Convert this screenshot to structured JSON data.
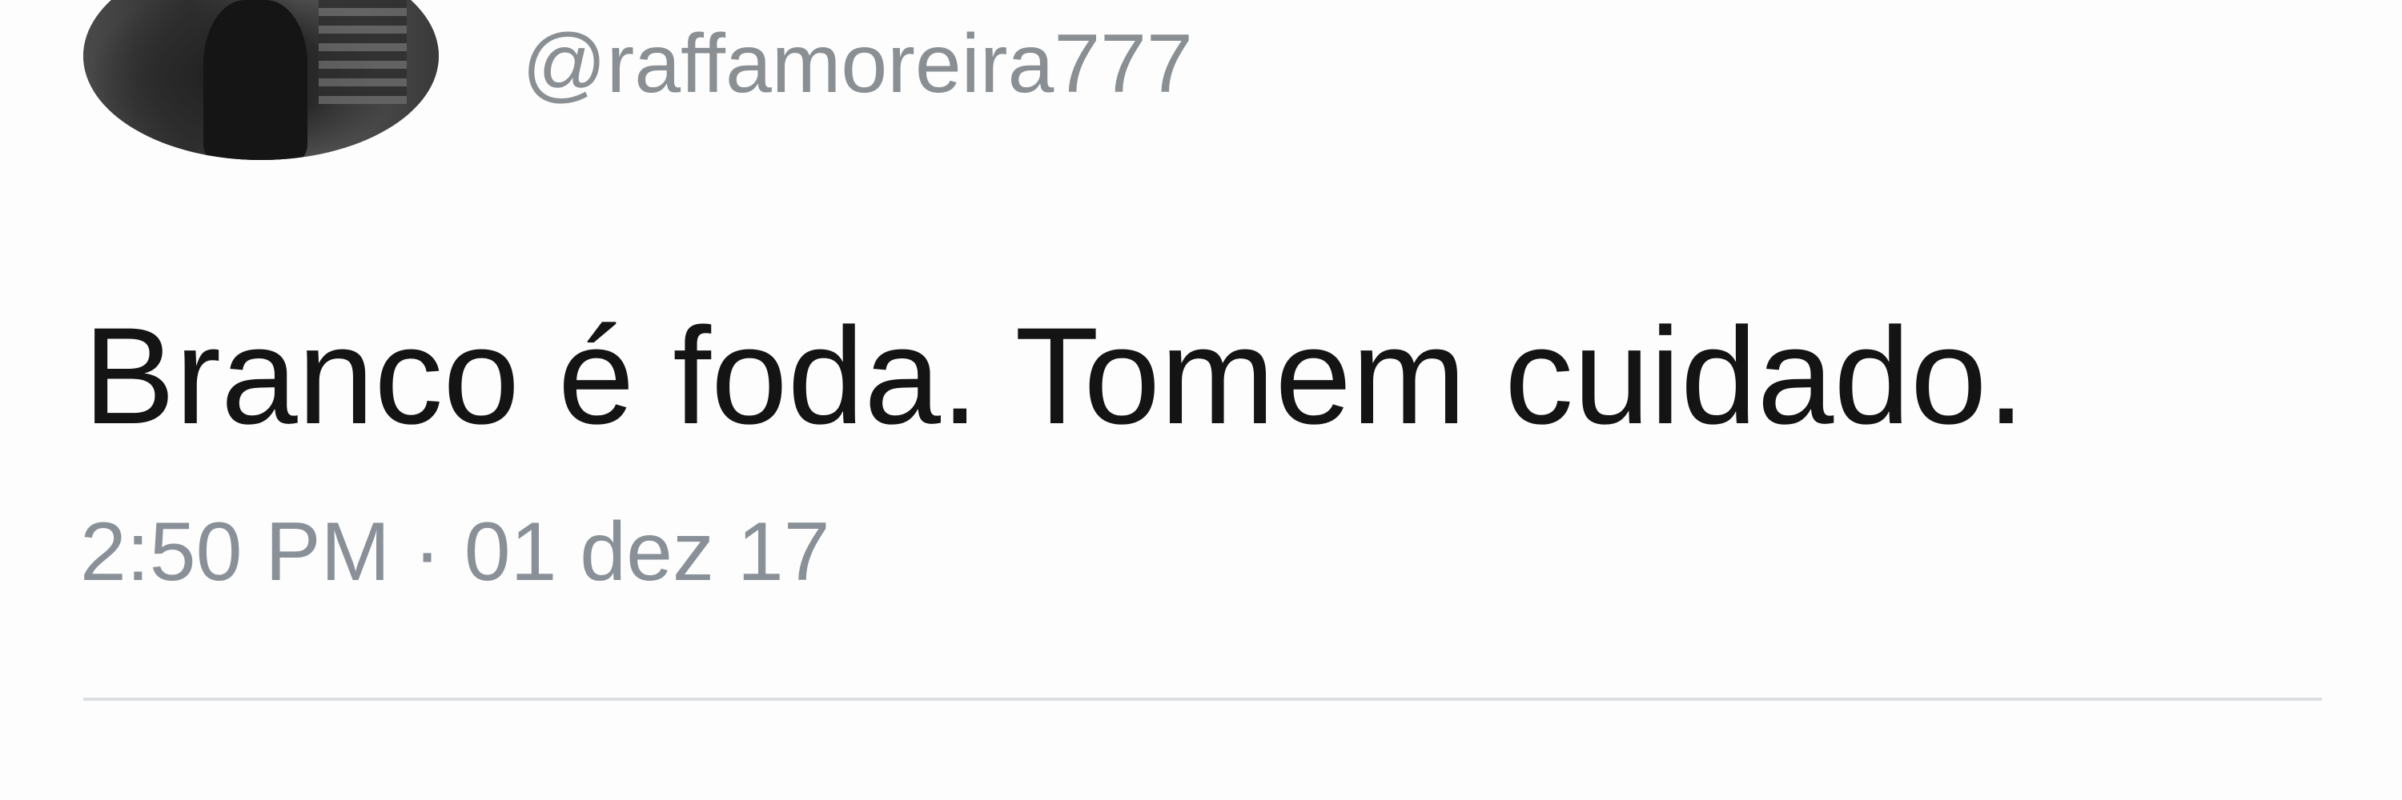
{
  "tweet": {
    "handle": "@raffamoreira777",
    "text": "Branco é foda. Tomem cuidado.",
    "timestamp": "2:50 PM · 01 dez 17"
  },
  "colors": {
    "text": "#141414",
    "secondary": "#8a8f94",
    "divider": "#dcdfe2",
    "background": "#fdfdfd"
  }
}
